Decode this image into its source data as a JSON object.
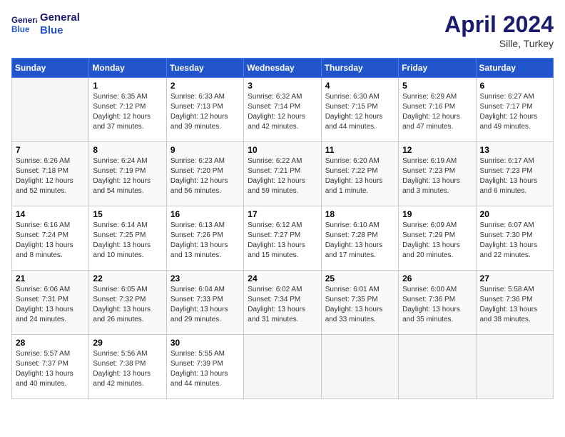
{
  "header": {
    "logo_line1": "General",
    "logo_line2": "Blue",
    "title": "April 2024",
    "location": "Sille, Turkey"
  },
  "days_of_week": [
    "Sunday",
    "Monday",
    "Tuesday",
    "Wednesday",
    "Thursday",
    "Friday",
    "Saturday"
  ],
  "weeks": [
    [
      {
        "day": "",
        "info": ""
      },
      {
        "day": "1",
        "info": "Sunrise: 6:35 AM\nSunset: 7:12 PM\nDaylight: 12 hours\nand 37 minutes."
      },
      {
        "day": "2",
        "info": "Sunrise: 6:33 AM\nSunset: 7:13 PM\nDaylight: 12 hours\nand 39 minutes."
      },
      {
        "day": "3",
        "info": "Sunrise: 6:32 AM\nSunset: 7:14 PM\nDaylight: 12 hours\nand 42 minutes."
      },
      {
        "day": "4",
        "info": "Sunrise: 6:30 AM\nSunset: 7:15 PM\nDaylight: 12 hours\nand 44 minutes."
      },
      {
        "day": "5",
        "info": "Sunrise: 6:29 AM\nSunset: 7:16 PM\nDaylight: 12 hours\nand 47 minutes."
      },
      {
        "day": "6",
        "info": "Sunrise: 6:27 AM\nSunset: 7:17 PM\nDaylight: 12 hours\nand 49 minutes."
      }
    ],
    [
      {
        "day": "7",
        "info": "Sunrise: 6:26 AM\nSunset: 7:18 PM\nDaylight: 12 hours\nand 52 minutes."
      },
      {
        "day": "8",
        "info": "Sunrise: 6:24 AM\nSunset: 7:19 PM\nDaylight: 12 hours\nand 54 minutes."
      },
      {
        "day": "9",
        "info": "Sunrise: 6:23 AM\nSunset: 7:20 PM\nDaylight: 12 hours\nand 56 minutes."
      },
      {
        "day": "10",
        "info": "Sunrise: 6:22 AM\nSunset: 7:21 PM\nDaylight: 12 hours\nand 59 minutes."
      },
      {
        "day": "11",
        "info": "Sunrise: 6:20 AM\nSunset: 7:22 PM\nDaylight: 13 hours\nand 1 minute."
      },
      {
        "day": "12",
        "info": "Sunrise: 6:19 AM\nSunset: 7:23 PM\nDaylight: 13 hours\nand 3 minutes."
      },
      {
        "day": "13",
        "info": "Sunrise: 6:17 AM\nSunset: 7:23 PM\nDaylight: 13 hours\nand 6 minutes."
      }
    ],
    [
      {
        "day": "14",
        "info": "Sunrise: 6:16 AM\nSunset: 7:24 PM\nDaylight: 13 hours\nand 8 minutes."
      },
      {
        "day": "15",
        "info": "Sunrise: 6:14 AM\nSunset: 7:25 PM\nDaylight: 13 hours\nand 10 minutes."
      },
      {
        "day": "16",
        "info": "Sunrise: 6:13 AM\nSunset: 7:26 PM\nDaylight: 13 hours\nand 13 minutes."
      },
      {
        "day": "17",
        "info": "Sunrise: 6:12 AM\nSunset: 7:27 PM\nDaylight: 13 hours\nand 15 minutes."
      },
      {
        "day": "18",
        "info": "Sunrise: 6:10 AM\nSunset: 7:28 PM\nDaylight: 13 hours\nand 17 minutes."
      },
      {
        "day": "19",
        "info": "Sunrise: 6:09 AM\nSunset: 7:29 PM\nDaylight: 13 hours\nand 20 minutes."
      },
      {
        "day": "20",
        "info": "Sunrise: 6:07 AM\nSunset: 7:30 PM\nDaylight: 13 hours\nand 22 minutes."
      }
    ],
    [
      {
        "day": "21",
        "info": "Sunrise: 6:06 AM\nSunset: 7:31 PM\nDaylight: 13 hours\nand 24 minutes."
      },
      {
        "day": "22",
        "info": "Sunrise: 6:05 AM\nSunset: 7:32 PM\nDaylight: 13 hours\nand 26 minutes."
      },
      {
        "day": "23",
        "info": "Sunrise: 6:04 AM\nSunset: 7:33 PM\nDaylight: 13 hours\nand 29 minutes."
      },
      {
        "day": "24",
        "info": "Sunrise: 6:02 AM\nSunset: 7:34 PM\nDaylight: 13 hours\nand 31 minutes."
      },
      {
        "day": "25",
        "info": "Sunrise: 6:01 AM\nSunset: 7:35 PM\nDaylight: 13 hours\nand 33 minutes."
      },
      {
        "day": "26",
        "info": "Sunrise: 6:00 AM\nSunset: 7:36 PM\nDaylight: 13 hours\nand 35 minutes."
      },
      {
        "day": "27",
        "info": "Sunrise: 5:58 AM\nSunset: 7:36 PM\nDaylight: 13 hours\nand 38 minutes."
      }
    ],
    [
      {
        "day": "28",
        "info": "Sunrise: 5:57 AM\nSunset: 7:37 PM\nDaylight: 13 hours\nand 40 minutes."
      },
      {
        "day": "29",
        "info": "Sunrise: 5:56 AM\nSunset: 7:38 PM\nDaylight: 13 hours\nand 42 minutes."
      },
      {
        "day": "30",
        "info": "Sunrise: 5:55 AM\nSunset: 7:39 PM\nDaylight: 13 hours\nand 44 minutes."
      },
      {
        "day": "",
        "info": ""
      },
      {
        "day": "",
        "info": ""
      },
      {
        "day": "",
        "info": ""
      },
      {
        "day": "",
        "info": ""
      }
    ]
  ]
}
